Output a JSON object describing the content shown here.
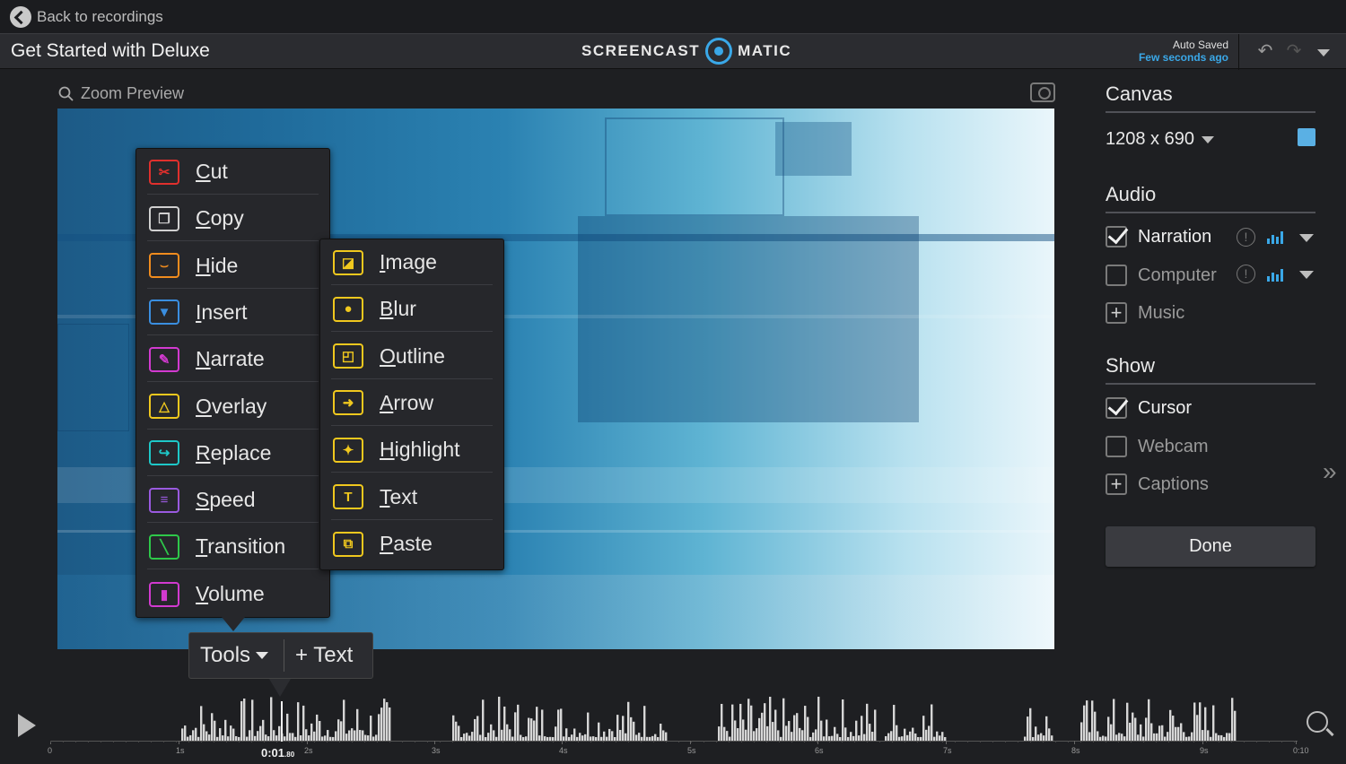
{
  "nav": {
    "back_label": "Back to recordings"
  },
  "header": {
    "title": "Get Started with Deluxe",
    "logo_left": "SCREENCAST",
    "logo_right": "MATIC",
    "autosave_label": "Auto Saved",
    "autosave_time": "Few seconds ago"
  },
  "preview": {
    "zoom_label": "Zoom Preview"
  },
  "tools_menu": {
    "items": [
      {
        "label": "Cut",
        "icon": "scissors-icon",
        "color": "#e0302d",
        "glyph": "✂"
      },
      {
        "label": "Copy",
        "icon": "copy-icon",
        "color": "#d0d0d0",
        "glyph": "❐"
      },
      {
        "label": "Hide",
        "icon": "closed-eye-icon",
        "color": "#f08c1e",
        "glyph": "⌣"
      },
      {
        "label": "Insert",
        "icon": "insert-icon",
        "color": "#3a8ee0",
        "glyph": "▼"
      },
      {
        "label": "Narrate",
        "icon": "microphone-icon",
        "color": "#d23ad0",
        "glyph": "✎"
      },
      {
        "label": "Overlay",
        "icon": "overlay-icon",
        "color": "#f0c81e",
        "glyph": "△"
      },
      {
        "label": "Replace",
        "icon": "replace-icon",
        "color": "#1ec8c8",
        "glyph": "↪"
      },
      {
        "label": "Speed",
        "icon": "speed-icon",
        "color": "#9a5ae0",
        "glyph": "≡"
      },
      {
        "label": "Transition",
        "icon": "transition-icon",
        "color": "#2ec84a",
        "glyph": "╲"
      },
      {
        "label": "Volume",
        "icon": "volume-icon",
        "color": "#d23ad0",
        "glyph": "▮"
      }
    ]
  },
  "overlay_menu": {
    "items": [
      {
        "label": "Image",
        "icon": "image-icon",
        "color": "#f0c81e",
        "glyph": "◪"
      },
      {
        "label": "Blur",
        "icon": "blur-drop-icon",
        "color": "#f0c81e",
        "glyph": "●"
      },
      {
        "label": "Outline",
        "icon": "outline-icon",
        "color": "#f0c81e",
        "glyph": "◰"
      },
      {
        "label": "Arrow",
        "icon": "arrow-icon",
        "color": "#f0c81e",
        "glyph": "➜"
      },
      {
        "label": "Highlight",
        "icon": "highlight-icon",
        "color": "#f0c81e",
        "glyph": "✦"
      },
      {
        "label": "Text",
        "icon": "text-icon",
        "color": "#f0c81e",
        "glyph": "T"
      },
      {
        "label": "Paste",
        "icon": "paste-icon",
        "color": "#f0c81e",
        "glyph": "⧉"
      }
    ]
  },
  "toolbar": {
    "tools_label": "Tools",
    "text_label": "+ Text"
  },
  "sidebar": {
    "canvas_title": "Canvas",
    "canvas_size": "1208 x 690",
    "canvas_color": "#5ab0e4",
    "audio_title": "Audio",
    "audio": {
      "narration": {
        "label": "Narration",
        "checked": true
      },
      "computer": {
        "label": "Computer",
        "checked": false
      },
      "music": {
        "label": "Music"
      }
    },
    "show_title": "Show",
    "show": {
      "cursor": {
        "label": "Cursor",
        "checked": true
      },
      "webcam": {
        "label": "Webcam",
        "checked": false
      },
      "captions": {
        "label": "Captions"
      }
    },
    "done_label": "Done"
  },
  "timeline": {
    "current_time": "0:01",
    "current_time_sub": ".80",
    "ticks": [
      "0",
      "1s",
      "2s",
      "3s",
      "4s",
      "5s",
      "6s",
      "7s",
      "8s",
      "9s",
      "0:10"
    ]
  },
  "colors": {
    "accent": "#3aa8e8"
  }
}
